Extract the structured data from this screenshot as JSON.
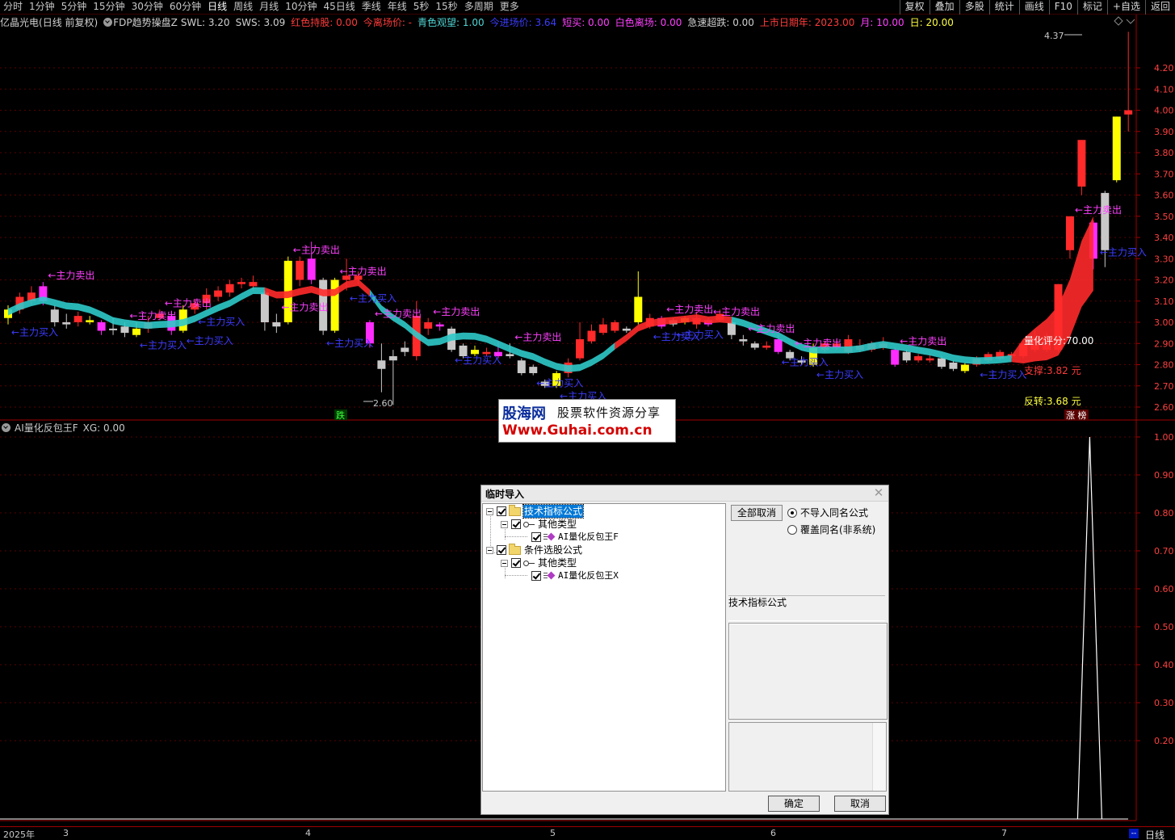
{
  "toolbar": {
    "period_tabs": [
      "分时",
      "1分钟",
      "5分钟",
      "15分钟",
      "30分钟",
      "60分钟",
      "日线",
      "周线",
      "月线",
      "10分钟",
      "45日线",
      "季线",
      "年线",
      "5秒",
      "15秒",
      "多周期",
      "更多"
    ],
    "active_tab": "日线",
    "right_buttons": [
      "复权",
      "叠加",
      "多股",
      "统计",
      "画线",
      "F10",
      "标记",
      "+自选",
      "返回"
    ]
  },
  "main_header": {
    "stock": "亿晶光电",
    "mode": "(日线 前复权)",
    "indicator": "FDP趋势操盘Z",
    "items": [
      {
        "label": "SWL: 3.20",
        "color": "#d0d0d0"
      },
      {
        "label": "SWS: 3.09",
        "color": "#d0d0d0"
      },
      {
        "label": "红色持股: 0.00",
        "color": "#ff3a3a"
      },
      {
        "label": "今离场价: -",
        "color": "#ff3a3a"
      },
      {
        "label": "青色观望: 1.00",
        "color": "#52d4d4"
      },
      {
        "label": "今进场价: 3.64",
        "color": "#3c3cff"
      },
      {
        "label": "短买: 0.00",
        "color": "#ff40ff"
      },
      {
        "label": "白色离场: 0.00",
        "color": "#ff40ff"
      },
      {
        "label": "急速超跌: 0.00",
        "color": "#d0d0d0"
      },
      {
        "label": "上市日期年: 2023.00",
        "color": "#ff3a3a"
      },
      {
        "label": "月: 10.00",
        "color": "#ff40ff"
      },
      {
        "label": "日: 20.00",
        "color": "#ffff40"
      }
    ]
  },
  "price_axis": [
    "4.20",
    "4.10",
    "4.00",
    "3.90",
    "3.80",
    "3.70",
    "3.60",
    "3.50",
    "3.40",
    "3.30",
    "3.20",
    "3.10",
    "3.00",
    "2.90",
    "2.80",
    "2.70",
    "2.60"
  ],
  "sub_axis": [
    "1.00",
    "0.90",
    "0.80",
    "0.70",
    "0.60",
    "0.50",
    "0.40",
    "0.30",
    "0.20"
  ],
  "chart_annotations": {
    "high_label": "4.37",
    "low_label": "2.60",
    "sell_label": "←主力卖出",
    "buy_label": "←主力买入",
    "score": "量化评分:70.00",
    "support": "支撑:3.82 元",
    "reversal": "反转:3.68 元",
    "down_tag": "跌",
    "limit_up_tag": "涨 榜"
  },
  "sub_header": {
    "indicator": "AI量化反包王F",
    "value": "XG: 0.00"
  },
  "watermark": {
    "logo": "股海网",
    "tagline": "股票软件资源分享",
    "url": "Www.Guhai.com.cn"
  },
  "dialog": {
    "title": "临时导入",
    "tree": [
      {
        "label": "技术指标公式",
        "level": 0,
        "type": "folder",
        "selected": true
      },
      {
        "label": "其他类型",
        "level": 1,
        "type": "key"
      },
      {
        "label": "AI量化反包王F",
        "level": 2,
        "type": "formula"
      },
      {
        "label": "条件选股公式",
        "level": 0,
        "type": "folder"
      },
      {
        "label": "其他类型",
        "level": 1,
        "type": "key"
      },
      {
        "label": "AI量化反包王X",
        "level": 2,
        "type": "formula"
      }
    ],
    "cancel_all_label": "全部取消",
    "radio_options": [
      {
        "label": "不导入同名公式",
        "selected": true
      },
      {
        "label": "覆盖同名(非系统)",
        "selected": false
      }
    ],
    "group_label": "技术指标公式",
    "ok_label": "确定",
    "cancel_label": "取消"
  },
  "date_axis": {
    "year_label": "2025年",
    "months": [
      "3",
      "4",
      "5",
      "6",
      "7"
    ],
    "period_badge": "日线"
  },
  "chart_data": {
    "type": "candlestick",
    "y_range": [
      2.55,
      4.4
    ],
    "note_series": [
      "price",
      "trend band",
      "AI signal"
    ],
    "candles": [
      [
        3.02,
        3.06,
        3.08,
        2.99,
        "y"
      ],
      [
        3.12,
        3.06,
        3.14,
        3.04,
        "r"
      ],
      [
        3.14,
        3.1,
        3.17,
        3.08,
        "r"
      ],
      [
        3.17,
        3.1,
        3.19,
        3.08,
        "m"
      ],
      [
        3.06,
        3.0,
        3.08,
        2.98,
        "g"
      ],
      [
        3.0,
        2.99,
        3.04,
        2.97,
        "w"
      ],
      [
        3.03,
        3.0,
        3.05,
        2.98,
        "r"
      ],
      [
        3.01,
        3.0,
        3.03,
        2.99,
        "y"
      ],
      [
        3.0,
        2.96,
        3.01,
        2.94,
        "m"
      ],
      [
        2.97,
        2.97,
        3.02,
        2.94,
        "g"
      ],
      [
        2.98,
        2.95,
        3.0,
        2.93,
        "g"
      ],
      [
        2.97,
        2.94,
        3.0,
        2.93,
        "y"
      ],
      [
        3.0,
        2.97,
        3.03,
        2.95,
        "r"
      ],
      [
        3.04,
        3.02,
        3.06,
        3.01,
        "r"
      ],
      [
        2.96,
        3.03,
        3.05,
        2.94,
        "m"
      ],
      [
        3.06,
        2.96,
        3.08,
        2.95,
        "y"
      ],
      [
        3.09,
        3.06,
        3.11,
        3.04,
        "r"
      ],
      [
        3.13,
        3.09,
        3.16,
        3.06,
        "r"
      ],
      [
        3.15,
        3.12,
        3.17,
        3.1,
        "r"
      ],
      [
        3.18,
        3.14,
        3.2,
        3.12,
        "r"
      ],
      [
        3.19,
        3.18,
        3.21,
        3.16,
        "r"
      ],
      [
        3.19,
        3.17,
        3.22,
        3.15,
        "r"
      ],
      [
        3.14,
        3.0,
        3.15,
        2.96,
        "g"
      ],
      [
        3.0,
        2.98,
        3.04,
        2.95,
        "g"
      ],
      [
        3.29,
        3.0,
        3.31,
        2.99,
        "y"
      ],
      [
        3.29,
        3.2,
        3.31,
        3.17,
        "r"
      ],
      [
        3.3,
        3.2,
        3.38,
        3.18,
        "m"
      ],
      [
        3.2,
        2.96,
        3.21,
        2.94,
        "g"
      ],
      [
        3.2,
        2.96,
        3.21,
        2.95,
        "y"
      ],
      [
        3.22,
        3.2,
        3.3,
        3.15,
        "r"
      ],
      [
        3.22,
        3.2,
        3.24,
        3.18,
        "r"
      ],
      [
        3.0,
        2.9,
        3.01,
        2.88,
        "m"
      ],
      [
        2.82,
        2.78,
        2.9,
        2.67,
        "g"
      ],
      [
        2.84,
        2.82,
        2.87,
        2.61,
        "g"
      ],
      [
        2.88,
        2.86,
        2.91,
        2.84,
        "g"
      ],
      [
        3.03,
        2.84,
        3.1,
        2.82,
        "r"
      ],
      [
        3.0,
        2.97,
        3.02,
        2.94,
        "r"
      ],
      [
        2.99,
        2.98,
        3.0,
        2.96,
        "m"
      ],
      [
        2.97,
        2.87,
        2.98,
        2.86,
        "g"
      ],
      [
        2.89,
        2.84,
        2.9,
        2.83,
        "g"
      ],
      [
        2.87,
        2.85,
        2.89,
        2.84,
        "y"
      ],
      [
        2.86,
        2.85,
        2.88,
        2.84,
        "r"
      ],
      [
        2.86,
        2.84,
        2.91,
        2.83,
        "m"
      ],
      [
        2.85,
        2.84,
        2.9,
        2.83,
        "w"
      ],
      [
        2.82,
        2.76,
        2.83,
        2.75,
        "g"
      ],
      [
        2.79,
        2.76,
        2.8,
        2.75,
        "g"
      ],
      [
        2.72,
        2.7,
        2.73,
        2.69,
        "g"
      ],
      [
        2.76,
        2.7,
        2.77,
        2.69,
        "y"
      ],
      [
        2.81,
        2.76,
        2.83,
        2.74,
        "r"
      ],
      [
        2.92,
        2.83,
        3.0,
        2.82,
        "r"
      ],
      [
        2.96,
        2.91,
        2.99,
        2.9,
        "r"
      ],
      [
        2.99,
        2.95,
        3.02,
        2.94,
        "r"
      ],
      [
        3.0,
        2.96,
        3.01,
        2.95,
        "r"
      ],
      [
        2.97,
        2.96,
        2.98,
        2.95,
        "w"
      ],
      [
        3.12,
        3.0,
        3.24,
        2.99,
        "y"
      ],
      [
        3.02,
        2.98,
        3.04,
        2.97,
        "r"
      ],
      [
        3.02,
        2.98,
        3.03,
        2.97,
        "m"
      ],
      [
        3.01,
        2.99,
        3.02,
        2.98,
        "w"
      ],
      [
        3.02,
        3.0,
        3.03,
        2.99,
        "y"
      ],
      [
        3.02,
        2.99,
        3.05,
        2.97,
        "r"
      ],
      [
        3.01,
        2.99,
        3.02,
        2.98,
        "m"
      ],
      [
        3.04,
        3.01,
        3.06,
        3.0,
        "r"
      ],
      [
        3.0,
        2.94,
        3.01,
        2.92,
        "g"
      ],
      [
        2.92,
        2.91,
        2.94,
        2.89,
        "g"
      ],
      [
        2.9,
        2.88,
        2.91,
        2.87,
        "g"
      ],
      [
        2.89,
        2.88,
        2.91,
        2.87,
        "r"
      ],
      [
        2.92,
        2.86,
        2.94,
        2.85,
        "m"
      ],
      [
        2.86,
        2.83,
        2.87,
        2.82,
        "w"
      ],
      [
        2.82,
        2.81,
        2.84,
        2.8,
        "w"
      ],
      [
        2.88,
        2.8,
        2.9,
        2.79,
        "y"
      ],
      [
        2.9,
        2.87,
        2.91,
        2.86,
        "r"
      ],
      [
        2.9,
        2.88,
        2.92,
        2.87,
        "r"
      ],
      [
        2.92,
        2.86,
        2.94,
        2.85,
        "r"
      ],
      [
        2.89,
        2.87,
        2.92,
        2.86,
        "r"
      ],
      [
        2.9,
        2.87,
        2.91,
        2.86,
        "r"
      ],
      [
        2.9,
        2.88,
        2.93,
        2.87,
        "r"
      ],
      [
        2.87,
        2.8,
        2.88,
        2.79,
        "m"
      ],
      [
        2.86,
        2.82,
        2.87,
        2.81,
        "w"
      ],
      [
        2.84,
        2.82,
        2.85,
        2.81,
        "r"
      ],
      [
        2.83,
        2.82,
        2.85,
        2.81,
        "r"
      ],
      [
        2.83,
        2.79,
        2.84,
        2.78,
        "w"
      ],
      [
        2.81,
        2.78,
        2.82,
        2.77,
        "g"
      ],
      [
        2.8,
        2.77,
        2.81,
        2.76,
        "y"
      ],
      [
        2.83,
        2.8,
        2.84,
        2.79,
        "r"
      ],
      [
        2.85,
        2.82,
        2.86,
        2.81,
        "r"
      ],
      [
        2.86,
        2.83,
        2.87,
        2.82,
        "r"
      ],
      [
        2.85,
        2.84,
        2.86,
        2.83,
        "r"
      ],
      [
        2.9,
        2.84,
        2.92,
        2.83,
        "r"
      ],
      [
        2.93,
        2.87,
        2.96,
        2.86,
        "r"
      ],
      [
        2.93,
        2.87,
        2.95,
        2.86,
        "r"
      ],
      [
        3.18,
        2.87,
        3.18,
        2.86,
        "r"
      ],
      [
        3.5,
        3.34,
        3.5,
        3.3,
        "r"
      ],
      [
        3.86,
        3.64,
        3.86,
        3.6,
        "r"
      ],
      [
        3.47,
        3.3,
        3.48,
        3.25,
        "m"
      ],
      [
        3.61,
        3.34,
        3.62,
        3.26,
        "g"
      ],
      [
        3.97,
        3.67,
        3.97,
        3.66,
        "y"
      ],
      [
        4.0,
        3.98,
        4.37,
        3.9,
        "r"
      ]
    ],
    "signal_spike_index": 92
  }
}
